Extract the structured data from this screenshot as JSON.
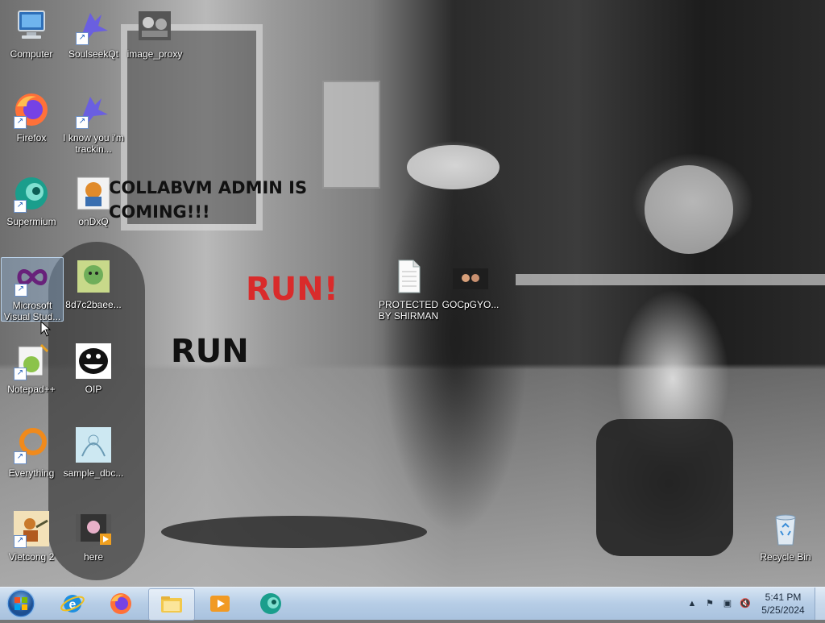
{
  "desktop": {
    "icons": [
      {
        "label": "Computer"
      },
      {
        "label": "SoulseekQt"
      },
      {
        "label": "image_proxy"
      },
      {
        "label": "Firefox"
      },
      {
        "label": "I know you i'm trackin..."
      },
      {
        "label": "Supermium"
      },
      {
        "label": "onDxQ"
      },
      {
        "label": "Microsoft Visual Stud..."
      },
      {
        "label": "8d7c2baee..."
      },
      {
        "label": "PROTECTED BY SHIRMAN"
      },
      {
        "label": "GOCpGYO..."
      },
      {
        "label": "Notepad++"
      },
      {
        "label": "OIP"
      },
      {
        "label": "Everything"
      },
      {
        "label": "sample_dbc..."
      },
      {
        "label": "Vietcong 2"
      },
      {
        "label": "here"
      },
      {
        "label": "Recycle Bin"
      }
    ],
    "wallpaper_text": {
      "line1": "COLLABVM ADMIN IS",
      "line2": "COMING!!!",
      "run_red": "RUN!",
      "run_black": "RUN"
    }
  },
  "taskbar": {
    "pinned": [
      "start-orb-icon",
      "internet-explorer-icon",
      "firefox-icon",
      "file-explorer-icon",
      "media-player-icon",
      "supermium-icon"
    ],
    "clock": {
      "time": "5:41 PM",
      "date": "5/25/2024"
    }
  },
  "colors": {
    "run_red": "#d92b2b",
    "taskbar": "#b6cde6",
    "selection": "#99c1eb"
  }
}
